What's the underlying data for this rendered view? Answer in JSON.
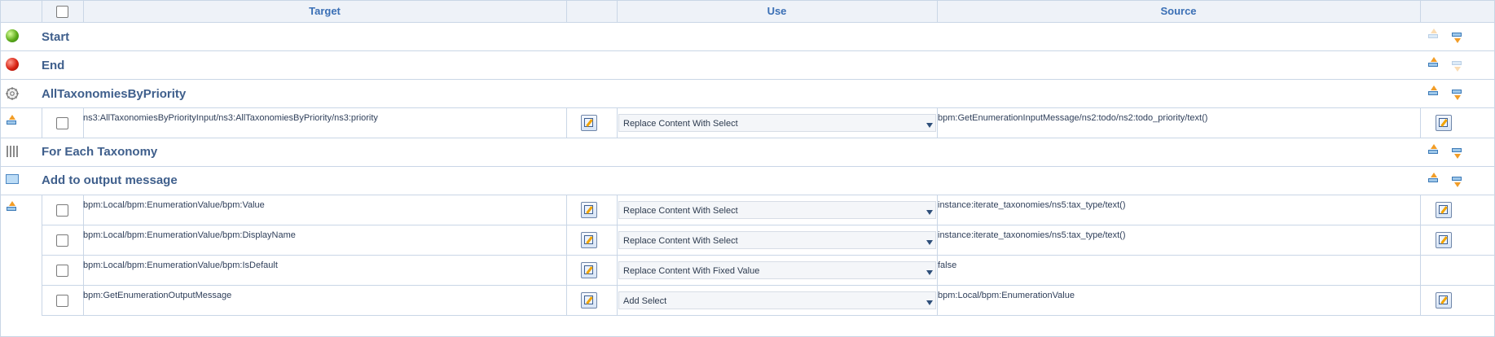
{
  "header": {
    "target_label": "Target",
    "use_label": "Use",
    "source_label": "Source"
  },
  "sections": {
    "start": "Start",
    "end": "End",
    "all_tax": "AllTaxonomiesByPriority",
    "for_each": "For Each Taxonomy",
    "add_output": "Add to output message"
  },
  "rows": [
    {
      "target": "ns3:AllTaxonomiesByPriorityInput/ns3:AllTaxonomiesByPriority/ns3:priority",
      "use": "Replace Content With Select",
      "source": "bpm:GetEnumerationInputMessage/ns2:todo/ns2:todo_priority/text()"
    },
    {
      "target": "bpm:Local/bpm:EnumerationValue/bpm:Value",
      "use": "Replace Content With Select",
      "source": "instance:iterate_taxonomies/ns5:tax_type/text()"
    },
    {
      "target": "bpm:Local/bpm:EnumerationValue/bpm:DisplayName",
      "use": "Replace Content With Select",
      "source": "instance:iterate_taxonomies/ns5:tax_type/text()"
    },
    {
      "target": "bpm:Local/bpm:EnumerationValue/bpm:IsDefault",
      "use": "Replace Content With Fixed Value",
      "source": "false"
    },
    {
      "target": "bpm:GetEnumerationOutputMessage",
      "use": "Add Select",
      "source": "bpm:Local/bpm:EnumerationValue"
    }
  ],
  "colors": {
    "header_bg": "#eef2f8",
    "border": "#c9d6e6",
    "header_text": "#3a6fb5",
    "section_text": "#3f5f8c"
  }
}
